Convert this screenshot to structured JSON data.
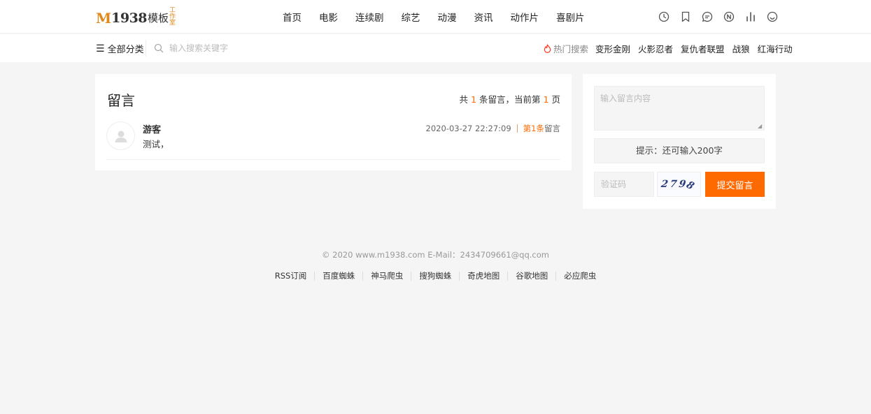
{
  "brand": {
    "m": "M",
    "number": "1938",
    "mb": "模板",
    "studio_chars": [
      "工",
      "作",
      "室"
    ]
  },
  "nav": {
    "items": [
      "首页",
      "电影",
      "连续剧",
      "综艺",
      "动漫",
      "资讯",
      "动作片",
      "喜剧片"
    ]
  },
  "header_icons": [
    "clock-icon",
    "bookmark-icon",
    "message-icon",
    "n-icon",
    "bar-chart-icon",
    "smile-icon"
  ],
  "subbar": {
    "all_categories": "全部分类",
    "search_placeholder": "输入搜索关键字",
    "hot_label": "热门搜索",
    "hot_items": [
      "变形金刚",
      "火影忍者",
      "复仇者联盟",
      "战狼",
      "红海行动"
    ]
  },
  "guestbook": {
    "title": "留言",
    "count_prefix": "共",
    "count": "1",
    "count_mid": "条留言，当前第",
    "page": "1",
    "count_suffix": "页",
    "comments": [
      {
        "author": "游客",
        "content": "测试，",
        "time": "2020-03-27 22:27:09",
        "floor": "第1条",
        "floor_suffix": "留言"
      }
    ]
  },
  "form": {
    "content_placeholder": "输入留言内容",
    "tip": "提示：还可输入200字",
    "code_placeholder": "验证码",
    "captcha": "279",
    "captcha_last": "8",
    "submit": "提交留言"
  },
  "footer": {
    "copyright": "© 2020 www.m1938.com  E-Mail：2434709661@qq.com",
    "links": [
      "RSS订阅",
      "百度蜘蛛",
      "神马爬虫",
      "搜狗蜘蛛",
      "奇虎地图",
      "谷歌地图",
      "必应爬虫"
    ]
  },
  "colors": {
    "accent": "#ff6a00",
    "brand_orange": "#e08a1e"
  }
}
